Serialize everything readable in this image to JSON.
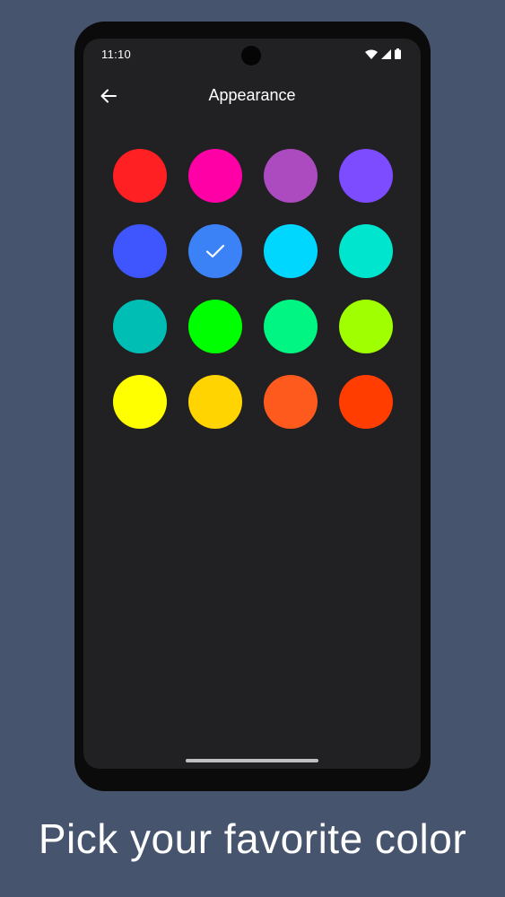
{
  "status_bar": {
    "time": "11:10",
    "icons": [
      "wifi-icon",
      "signal-icon",
      "battery-icon"
    ]
  },
  "app_bar": {
    "title": "Appearance",
    "back_icon": "arrow-back-icon"
  },
  "swatches": [
    {
      "color": "#ff2024",
      "selected": false
    },
    {
      "color": "#ff00a6",
      "selected": false
    },
    {
      "color": "#ac4ac0",
      "selected": false
    },
    {
      "color": "#7d4cff",
      "selected": false
    },
    {
      "color": "#3f56ff",
      "selected": false
    },
    {
      "color": "#3b82f6",
      "selected": true
    },
    {
      "color": "#00d7ff",
      "selected": false
    },
    {
      "color": "#00e5cd",
      "selected": false
    },
    {
      "color": "#00beb4",
      "selected": false
    },
    {
      "color": "#00ff00",
      "selected": false
    },
    {
      "color": "#00f582",
      "selected": false
    },
    {
      "color": "#a0ff00",
      "selected": false
    },
    {
      "color": "#ffff00",
      "selected": false
    },
    {
      "color": "#ffd400",
      "selected": false
    },
    {
      "color": "#ff5a1e",
      "selected": false
    },
    {
      "color": "#ff3d00",
      "selected": false
    }
  ],
  "caption": "Pick your favorite color",
  "theme": {
    "background": "#46546d",
    "screen": "#212023",
    "accent": "#3b82f6"
  }
}
